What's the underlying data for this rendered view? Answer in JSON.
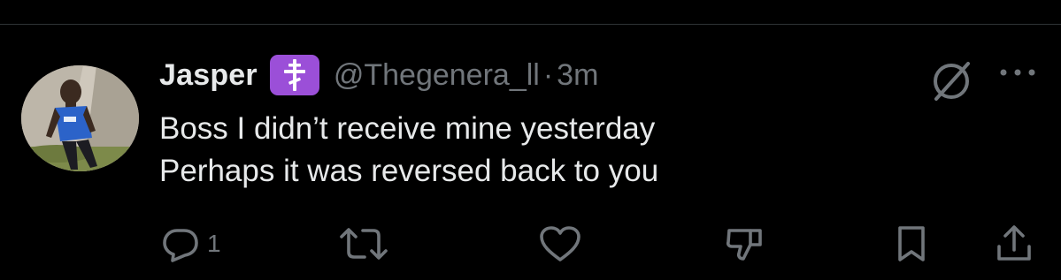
{
  "tweet": {
    "author_name": "Jasper",
    "badge_glyph": "☦",
    "handle": "@Thegenera_ll",
    "separator": "·",
    "timestamp": "3m",
    "text_lines": [
      "Boss I didn’t receive mine yesterday",
      "Perhaps it was reversed back to you"
    ]
  },
  "actions": {
    "reply_count": "1",
    "icons": [
      "reply-icon",
      "repost-icon",
      "like-icon",
      "dislike-icon",
      "bookmark-icon",
      "share-icon"
    ]
  },
  "header_icons": [
    "grok-icon",
    "more-icon"
  ],
  "colors": {
    "background": "#000000",
    "primary_text": "#e7e9ea",
    "secondary_text": "#71767b",
    "badge": "#9b4fd8",
    "divider": "#2f3336"
  }
}
